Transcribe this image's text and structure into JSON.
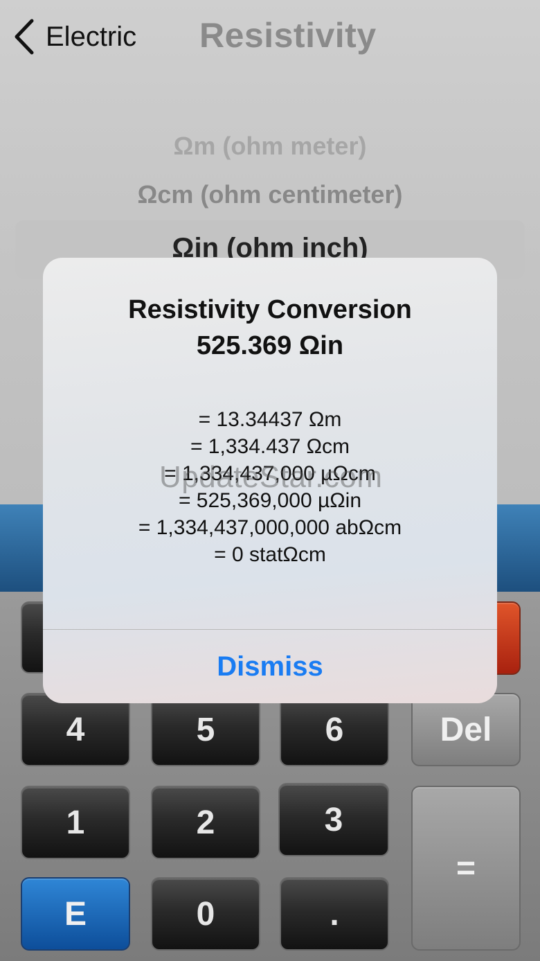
{
  "nav": {
    "back_label": "Electric",
    "title": "Resistivity"
  },
  "picker": {
    "items": [
      "Ωm (ohm meter)",
      "Ωcm (ohm centimeter)"
    ],
    "selected": "Ωin (ohm inch)"
  },
  "keypad": {
    "keys": [
      "4",
      "5",
      "6",
      "Del",
      "1",
      "2",
      "3",
      "=",
      "E",
      "0",
      "."
    ]
  },
  "alert": {
    "title": "Resistivity Conversion",
    "value": "525.369 Ωin",
    "lines": [
      "= 13.34437 Ωm",
      "= 1,334.437 Ωcm",
      "= 1,334,437,000 µΩcm",
      "= 525,369,000 µΩin",
      "= 1,334,437,000,000 abΩcm",
      "= 0 statΩcm"
    ],
    "dismiss_label": "Dismiss"
  },
  "watermark": "UpdateStar.com",
  "colors": {
    "accent": "#1a7cf2",
    "display_band": "#2a6aa0",
    "key_blue": "#1c63b5",
    "key_red": "#c8361a"
  }
}
